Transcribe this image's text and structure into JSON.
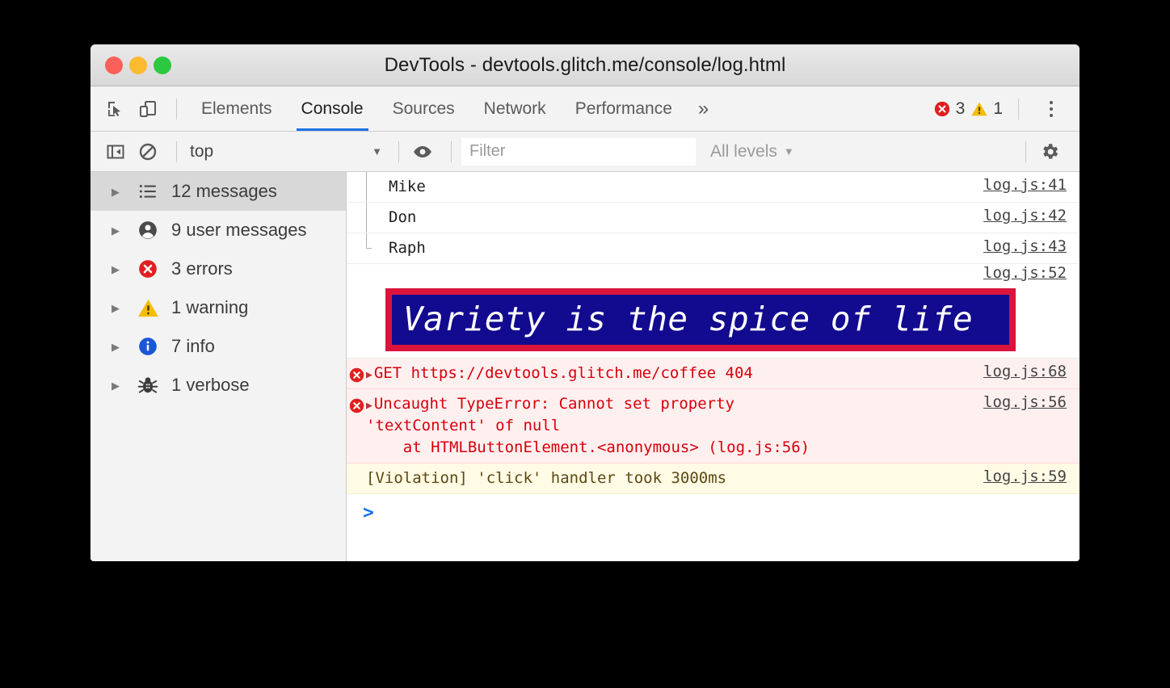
{
  "window": {
    "title": "DevTools - devtools.glitch.me/console/log.html",
    "traffic_lights": [
      "close",
      "minimize",
      "zoom"
    ]
  },
  "toolbar": {
    "inspect_icon": "inspect-element-icon",
    "device_icon": "device-toolbar-icon",
    "tabs": [
      {
        "label": "Elements",
        "active": false
      },
      {
        "label": "Console",
        "active": true
      },
      {
        "label": "Sources",
        "active": false
      },
      {
        "label": "Network",
        "active": false
      },
      {
        "label": "Performance",
        "active": false
      }
    ],
    "more_tabs": "»",
    "error_count": "3",
    "warning_count": "1",
    "menu_icon": "kebab-menu-icon",
    "active_tab_accent": "#1a73e8"
  },
  "console_toolbar": {
    "sidebar_toggle_icon": "sidebar-toggle-icon",
    "clear_icon": "clear-console-icon",
    "context": "top",
    "context_caret": "▼",
    "eye_icon": "live-expression-eye-icon",
    "filter_placeholder": "Filter",
    "filter_value": "",
    "levels": "All levels",
    "levels_caret": "▼",
    "settings_icon": "gear-icon"
  },
  "sidebar": {
    "items": [
      {
        "label": "12 messages",
        "icon": "list-icon",
        "selected": true,
        "arrow": "▶"
      },
      {
        "label": "9 user messages",
        "icon": "user-icon",
        "selected": false,
        "arrow": "▶"
      },
      {
        "label": "3 errors",
        "icon": "error-icon",
        "selected": false,
        "arrow": "▶"
      },
      {
        "label": "1 warning",
        "icon": "warning-icon",
        "selected": false,
        "arrow": "▶"
      },
      {
        "label": "7 info",
        "icon": "info-icon",
        "selected": false,
        "arrow": "▶"
      },
      {
        "label": "1 verbose",
        "icon": "bug-icon",
        "selected": false,
        "arrow": "▶"
      }
    ]
  },
  "console": {
    "rows": [
      {
        "kind": "plain",
        "group_child": true,
        "text": "Mike",
        "source": "log.js:41"
      },
      {
        "kind": "plain",
        "group_child": true,
        "text": "Don",
        "source": "log.js:42"
      },
      {
        "kind": "plain",
        "group_child": true,
        "group_last": true,
        "text": "Raph",
        "source": "log.js:43"
      },
      {
        "kind": "banner",
        "text": "Variety is the spice of life",
        "source": "log.js:52",
        "border_color": "#dc143c",
        "fill_color": "#120a8f",
        "text_color": "#ffffff"
      },
      {
        "kind": "error",
        "disclosure": "▶",
        "prefix": "GET ",
        "link": "https://devtools.glitch.me/coffee",
        "suffix": " 404",
        "source": "log.js:68"
      },
      {
        "kind": "error",
        "disclosure": "▶",
        "line1": "Uncaught TypeError: Cannot set property",
        "line2": "'textContent' of null",
        "line3_pre": "    at HTMLButtonElement.<anonymous> (",
        "line3_link": "log.js:56",
        "line3_post": ")",
        "source": "log.js:56"
      },
      {
        "kind": "warn",
        "text": "[Violation] 'click' handler took 3000ms",
        "source": "log.js:59"
      }
    ],
    "prompt": ">",
    "prompt_color": "#1a73e8",
    "error_row_bg": "#fff0f0",
    "warn_row_bg": "#fffbe5"
  }
}
